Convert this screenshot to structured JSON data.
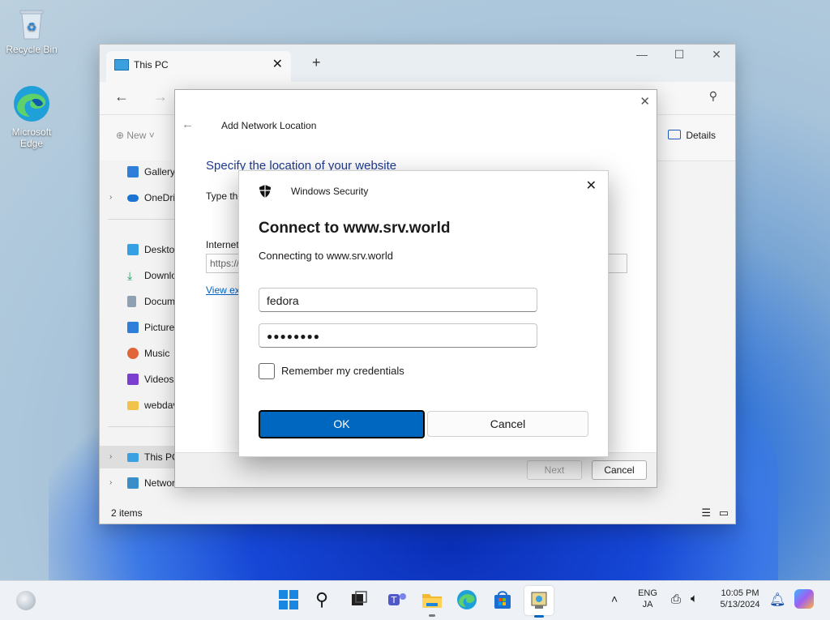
{
  "desktop": {
    "icons": [
      {
        "label": "Recycle Bin"
      },
      {
        "label": "Microsoft Edge"
      }
    ]
  },
  "explorer": {
    "tab_title": "This PC",
    "new_label": "New",
    "details_label": "Details",
    "sidebar": [
      {
        "label": "Gallery"
      },
      {
        "label": "OneDrive"
      },
      {
        "label": "Desktop"
      },
      {
        "label": "Downloads"
      },
      {
        "label": "Documents"
      },
      {
        "label": "Pictures"
      },
      {
        "label": "Music"
      },
      {
        "label": "Videos"
      },
      {
        "label": "webdav"
      },
      {
        "label": "This PC"
      },
      {
        "label": "Network"
      }
    ],
    "status": "2 items"
  },
  "add_network_location": {
    "title": "Add Network Location",
    "heading": "Specify the location of your website",
    "type_text": "Type the",
    "internet_label": "Internet",
    "address_placeholder": "https://",
    "view_examples": "View ex",
    "next_label": "Next",
    "cancel_label": "Cancel"
  },
  "windows_security": {
    "app_title": "Windows Security",
    "heading": "Connect to www.srv.world",
    "subtext": "Connecting to www.srv.world",
    "username": "fedora",
    "password_mask": "●●●●●●●●",
    "remember_label": "Remember my credentials",
    "ok_label": "OK",
    "cancel_label": "Cancel"
  },
  "taskbar": {
    "lang_top": "ENG",
    "lang_bottom": "JA",
    "time": "10:05 PM",
    "date": "5/13/2024"
  },
  "colors": {
    "accent": "#0067c0",
    "link": "#0066cc",
    "heading_blue": "#1f3a93"
  }
}
